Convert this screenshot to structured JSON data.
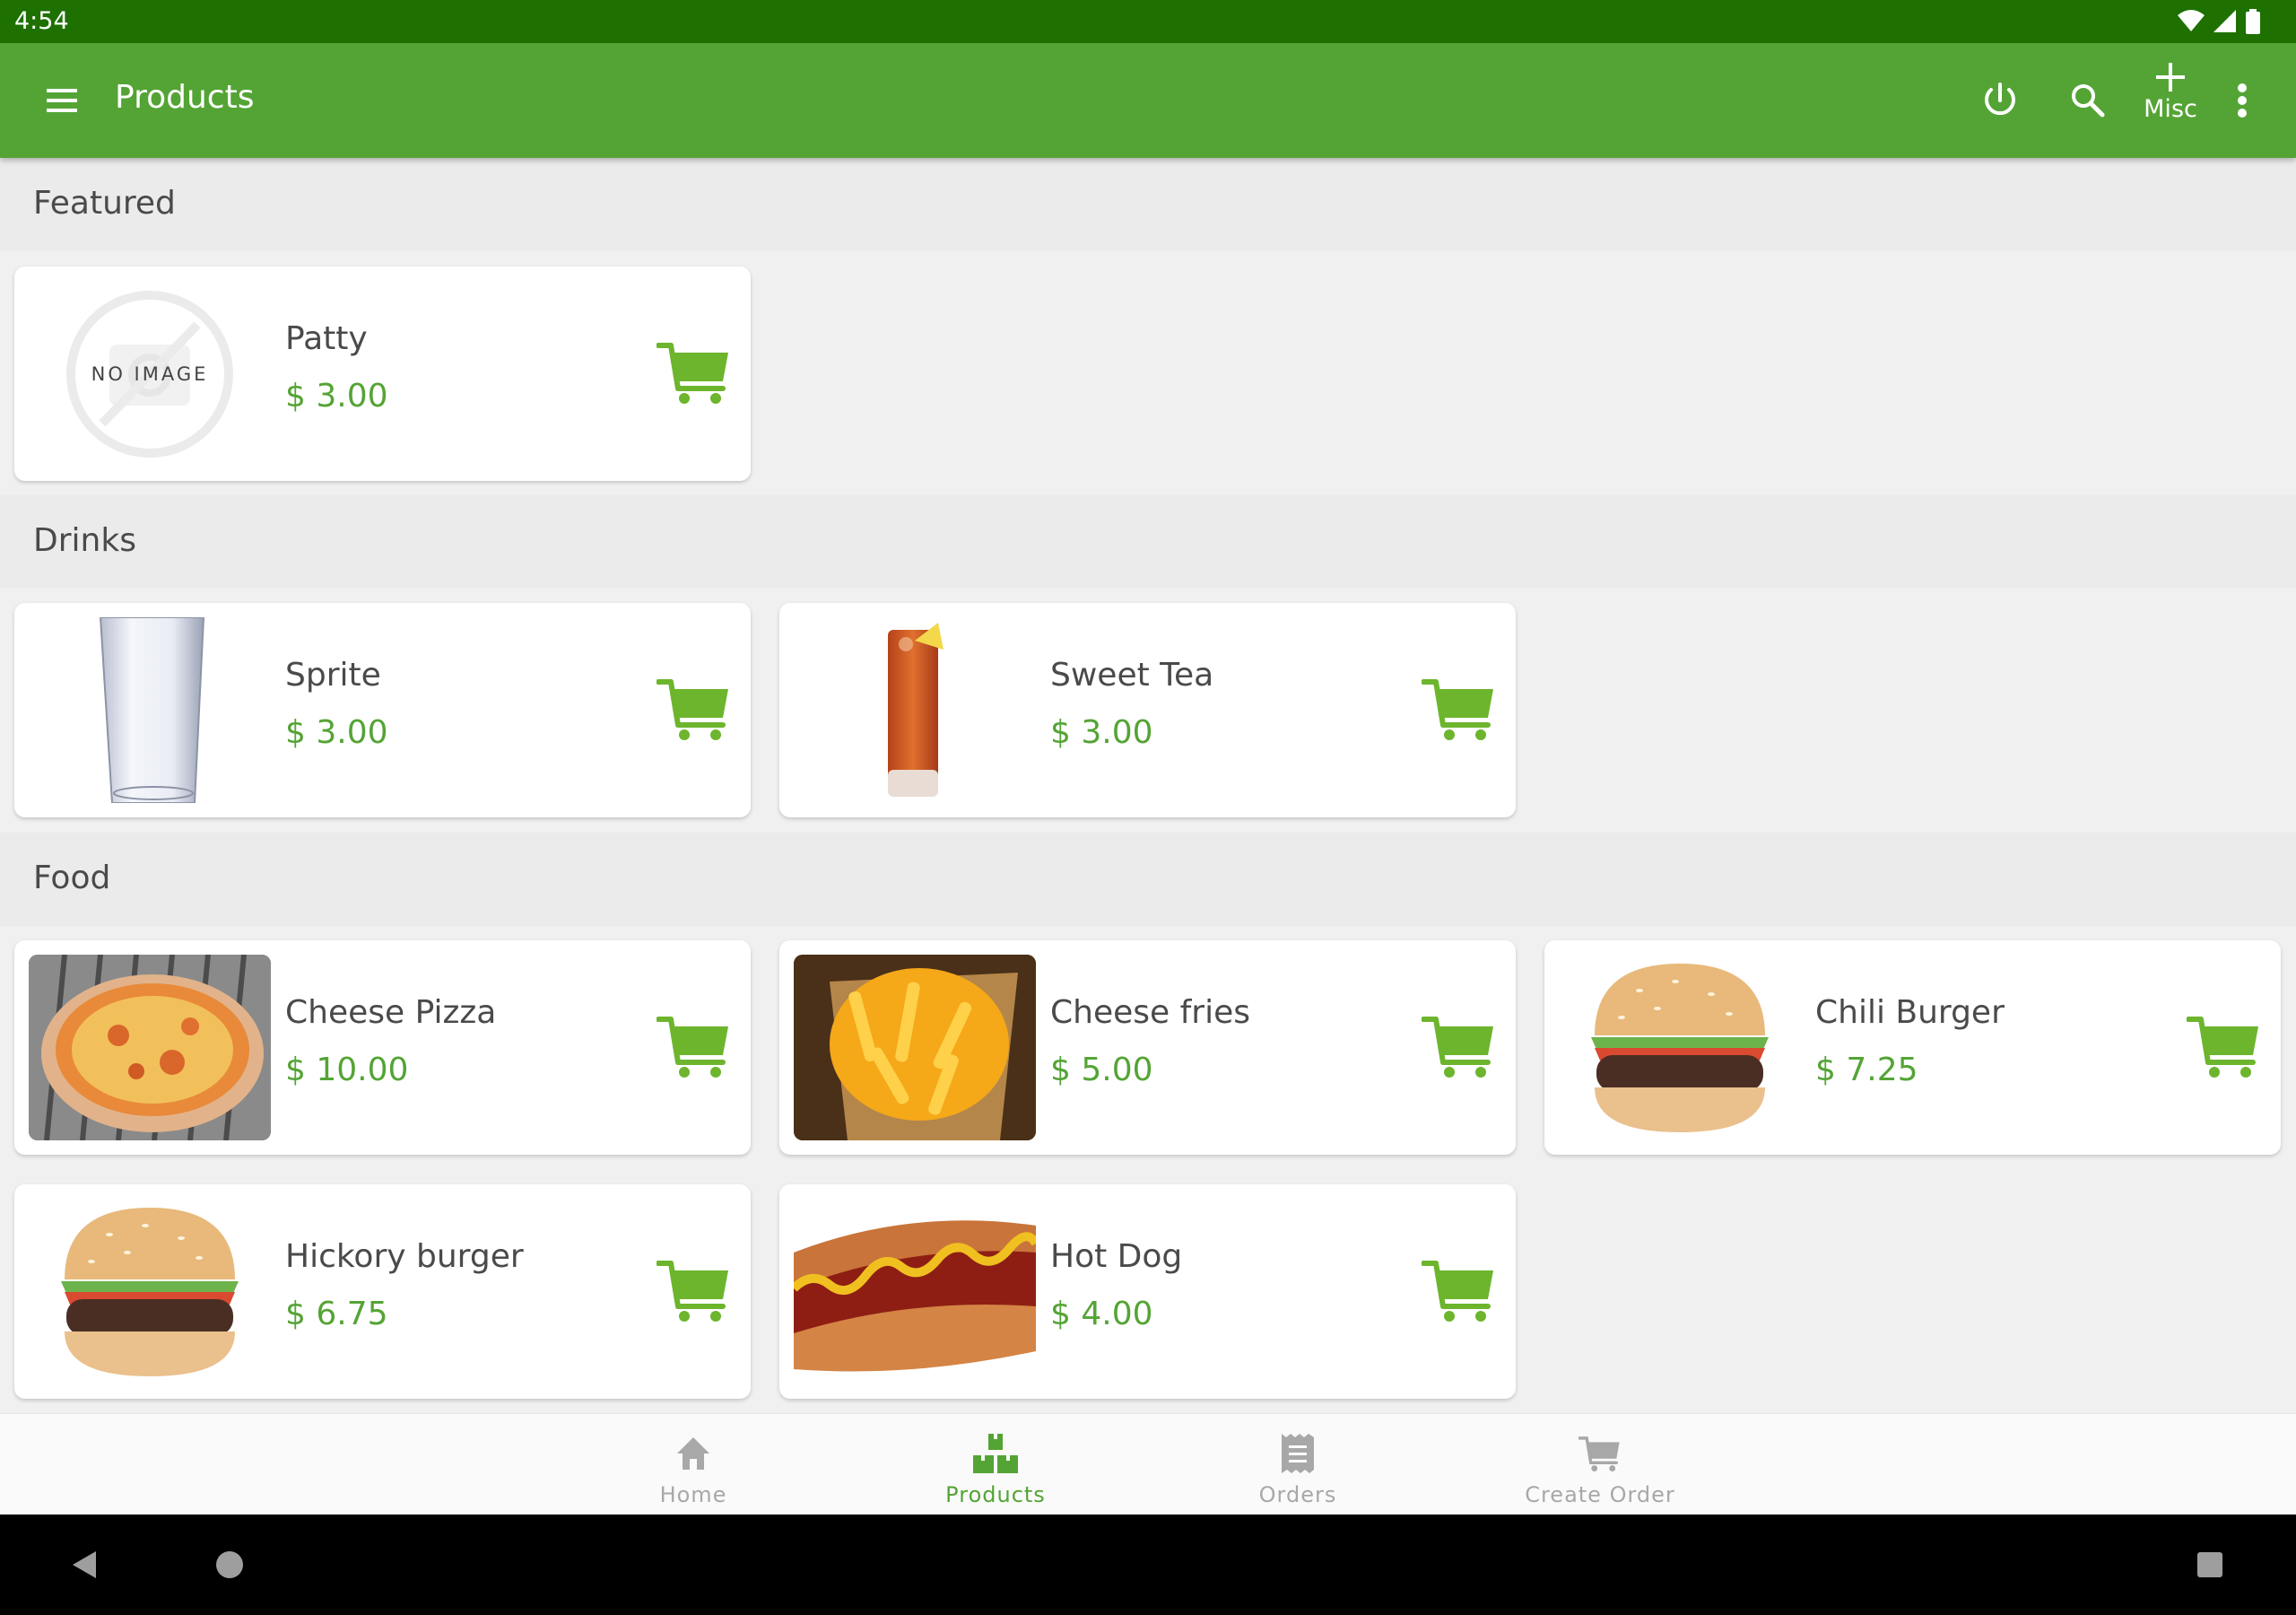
{
  "status_bar": {
    "time": "4:54",
    "icons": [
      "wifi-icon",
      "signal-icon",
      "battery-icon"
    ]
  },
  "app_bar": {
    "title": "Products",
    "menu_icon": "hamburger-menu-icon",
    "actions": [
      {
        "name": "power",
        "icon": "power-icon"
      },
      {
        "name": "search",
        "icon": "search-icon"
      },
      {
        "name": "misc",
        "icon": "plus-icon",
        "label": "Misc"
      },
      {
        "name": "overflow",
        "icon": "more-vert-icon"
      }
    ]
  },
  "colors": {
    "status_bar": "#1e7100",
    "app_bar": "#54a435",
    "accent": "#54a435",
    "cart": "#6cb52d",
    "text": "#4a4a4a",
    "nav_inactive": "#a8a8a8"
  },
  "sections": [
    {
      "title": "Featured",
      "products": [
        {
          "name": "Patty",
          "price": "$ 3.00",
          "image": "no-image",
          "image_text": "NO IMAGE"
        }
      ]
    },
    {
      "title": "Drinks",
      "products": [
        {
          "name": "Sprite",
          "price": "$ 3.00",
          "image": "empty-glass"
        },
        {
          "name": "Sweet Tea",
          "price": "$ 3.00",
          "image": "iced-tea"
        }
      ]
    },
    {
      "title": "Food",
      "products": [
        {
          "name": "Cheese Pizza",
          "price": "$ 10.00",
          "image": "pizza"
        },
        {
          "name": "Cheese fries",
          "price": "$ 5.00",
          "image": "cheese-fries"
        },
        {
          "name": "Chili Burger",
          "price": "$ 7.25",
          "image": "burger"
        },
        {
          "name": "Hickory burger",
          "price": "$ 6.75",
          "image": "burger"
        },
        {
          "name": "Hot Dog",
          "price": "$ 4.00",
          "image": "hot-dog"
        }
      ]
    }
  ],
  "bottom_nav": {
    "items": [
      {
        "label": "Home",
        "icon": "home-icon",
        "active": false
      },
      {
        "label": "Products",
        "icon": "boxes-icon",
        "active": true
      },
      {
        "label": "Orders",
        "icon": "receipt-icon",
        "active": false
      },
      {
        "label": "Create Order",
        "icon": "cart-icon",
        "active": false
      }
    ]
  },
  "system_nav": {
    "buttons": [
      "back",
      "home",
      "recents"
    ]
  }
}
